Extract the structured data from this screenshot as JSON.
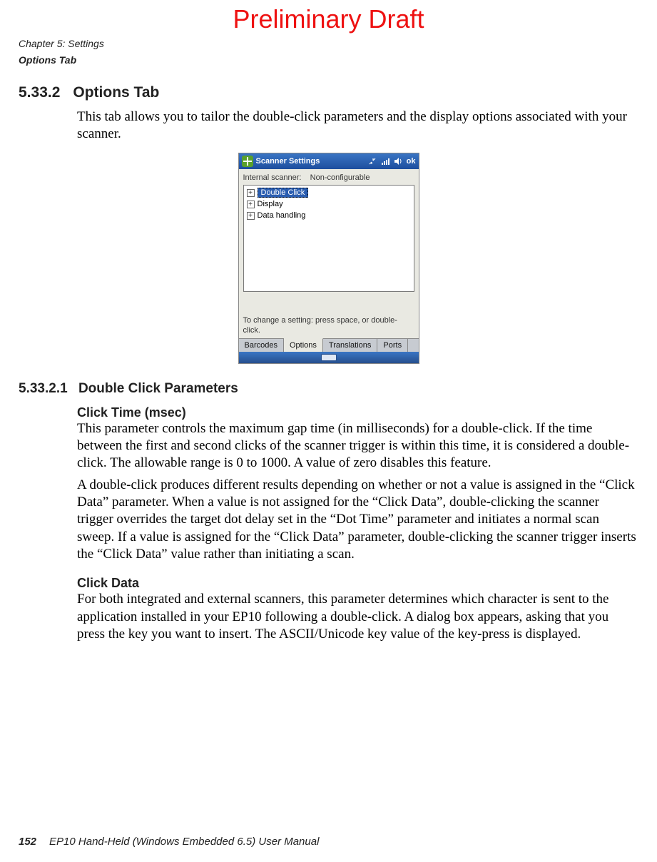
{
  "draft_label": "Preliminary Draft",
  "chapter_line1": "Chapter 5: Settings",
  "chapter_line2": "Options Tab",
  "sec": {
    "num": "5.33.2",
    "title": "Options Tab",
    "intro": "This tab allows you to tailor the double-click parameters and the display options associated with your scanner."
  },
  "sub": {
    "num": "5.33.2.1",
    "title": "Double Click Parameters"
  },
  "click_time": {
    "heading": "Click Time (msec)",
    "p1": "This parameter controls the maximum gap time (in milliseconds) for a double-click. If the time between the first and second clicks of the scanner trigger is within this time, it is considered a double-click. The allowable range is 0 to 1000. A value of zero disables this feature.",
    "p2": "A double-click produces different results depending on whether or not a value is assigned in the “Click Data” parameter. When a value is not assigned for the “Click Data”, double-clicking the scanner trigger overrides the target dot delay set in the “Dot Time” parameter and initiates a normal scan sweep. If a value is assigned for the “Click Data” parameter, double-clicking the scanner trigger inserts the “Click Data” value rather than initiating a scan."
  },
  "click_data": {
    "heading": "Click Data",
    "p1": "For both integrated and external scanners, this parameter determines which character is sent to the application installed in your EP10 following a double-click. A dialog box appears, asking that you press the key you want to insert. The ASCII/Unicode key value of the key-press is displayed."
  },
  "footer": {
    "page": "152",
    "doc": "EP10 Hand-Held (Windows Embedded 6.5) User Manual"
  },
  "shot": {
    "title": "Scanner Settings",
    "ok": "ok",
    "internal_label": "Internal scanner:",
    "internal_value": "Non-configurable",
    "tree": [
      "Double Click",
      "Display",
      "Data handling"
    ],
    "hint": "To change a setting: press space, or double-click.",
    "tabs": [
      "Barcodes",
      "Options",
      "Translations",
      "Ports"
    ],
    "active_tab_index": 1
  }
}
